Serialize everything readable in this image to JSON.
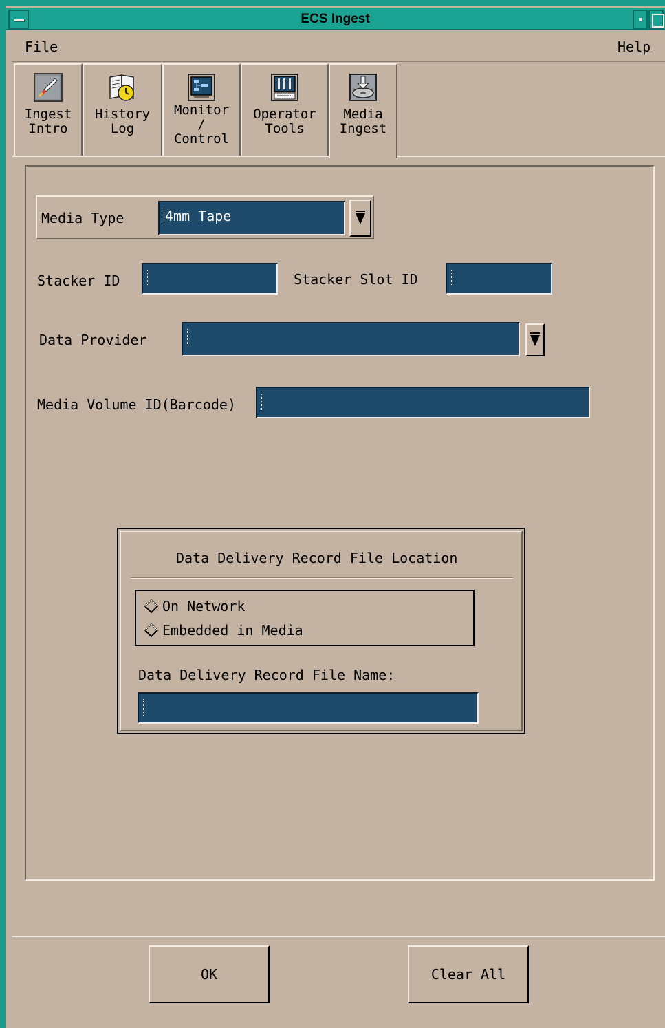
{
  "window": {
    "title": "ECS Ingest"
  },
  "menubar": {
    "file_label": "File",
    "help_label": "Help"
  },
  "tabs": [
    {
      "line1": "Ingest",
      "line2": "Intro",
      "line3": "",
      "icon": "rocket-icon"
    },
    {
      "line1": "History",
      "line2": "Log",
      "line3": "",
      "icon": "history-book-icon"
    },
    {
      "line1": "Monitor",
      "line2": "/",
      "line3": "Control",
      "icon": "monitor-control-icon"
    },
    {
      "line1": "Operator",
      "line2": "Tools",
      "line3": "",
      "icon": "operator-tools-icon"
    },
    {
      "line1": "Media",
      "line2": "Ingest",
      "line3": "",
      "icon": "media-ingest-icon"
    }
  ],
  "active_tab": "Media Ingest",
  "form": {
    "media_type_label": "Media Type",
    "media_type_value": "4mm Tape",
    "stacker_id_label": "Stacker ID",
    "stacker_id_value": "",
    "stacker_slot_label": "Stacker Slot ID",
    "stacker_slot_value": "",
    "data_provider_label": "Data Provider",
    "data_provider_value": "",
    "media_volume_label": "Media Volume ID(Barcode)",
    "media_volume_value": ""
  },
  "ddr": {
    "group_title": "Data Delivery Record File Location",
    "option_network": "On Network",
    "option_embedded": "Embedded in Media",
    "filename_label": "Data Delivery Record File Name:",
    "filename_value": ""
  },
  "buttons": {
    "ok": "OK",
    "clear_all": "Clear All"
  },
  "colors": {
    "frame": "#1a9a8a",
    "background": "#c4b3a2",
    "field": "#1e4b6c"
  }
}
